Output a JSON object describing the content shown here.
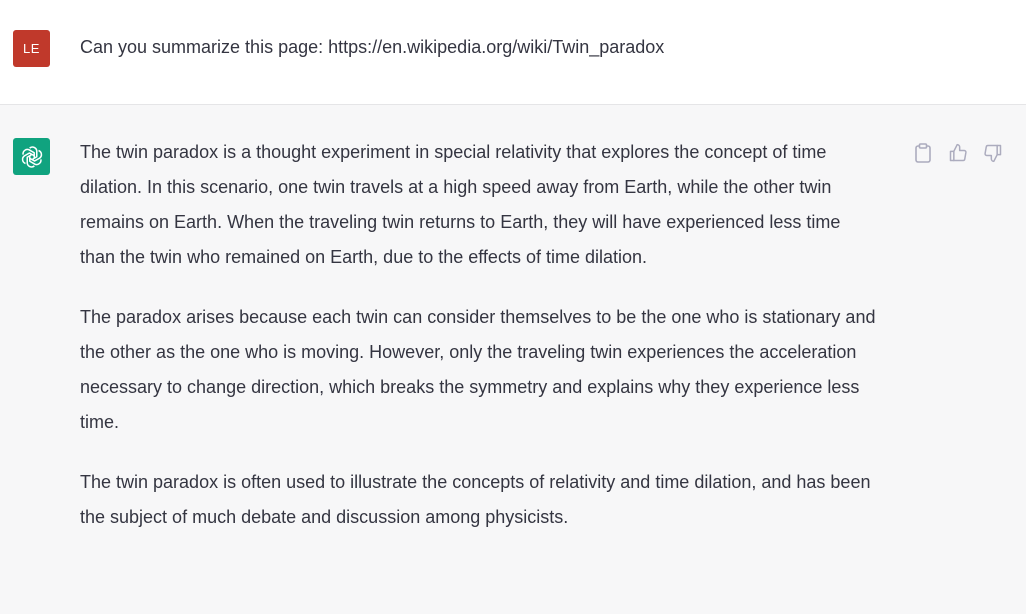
{
  "user_message": {
    "avatar_initials": "LE",
    "text": "Can you summarize this page: https://en.wikipedia.org/wiki/Twin_paradox"
  },
  "assistant_message": {
    "avatar_icon": "openai-logo-icon",
    "paragraphs": [
      "The twin paradox is a thought experiment in special relativity that explores the concept of time dilation. In this scenario, one twin travels at a high speed away from Earth, while the other twin remains on Earth. When the traveling twin returns to Earth, they will have experienced less time than the twin who remained on Earth, due to the effects of time dilation.",
      "The paradox arises because each twin can consider themselves to be the one who is stationary and the other as the one who is moving. However, only the traveling twin experiences the acceleration necessary to change direction, which breaks the symmetry and explains why they experience less time.",
      "The twin paradox is often used to illustrate the concepts of relativity and time dilation, and has been the subject of much debate and discussion among physicists."
    ],
    "actions": [
      "clipboard-icon",
      "thumbs-up-icon",
      "thumbs-down-icon"
    ]
  },
  "colors": {
    "user_avatar_bg": "#c0392b",
    "assistant_avatar_bg": "#10a37f",
    "assistant_row_bg": "#f7f7f8",
    "text": "#343541",
    "icon": "#acacbe"
  }
}
